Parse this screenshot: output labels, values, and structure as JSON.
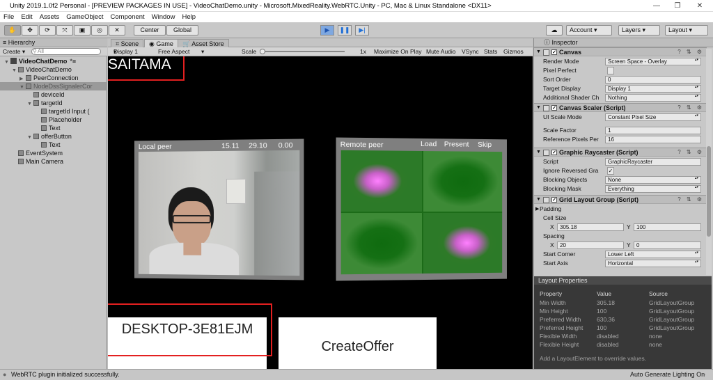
{
  "window": {
    "title": "Unity 2019.1.0f2 Personal - [PREVIEW PACKAGES IN USE] - VideoChatDemo.unity - Microsoft.MixedReality.WebRTC.Unity - PC, Mac & Linux Standalone <DX11>",
    "minimize": "—",
    "restore": "❐",
    "close": "✕"
  },
  "menu": [
    "File",
    "Edit",
    "Assets",
    "GameObject",
    "Component",
    "Window",
    "Help"
  ],
  "toolbar": {
    "center": "Center",
    "global": "Global",
    "account": "Account",
    "layers": "Layers",
    "layout": "Layout",
    "accent": "#1f6fd6"
  },
  "hierarchy": {
    "title": "Hierarchy",
    "create": "Create",
    "search_placeholder": "All",
    "items": [
      {
        "label": "VideoChatDemo",
        "indent": 0,
        "arrow": "▼",
        "bold": true,
        "suffix": "*≡"
      },
      {
        "label": "VideoChatDemo",
        "indent": 1,
        "arrow": "▼"
      },
      {
        "label": "PeerConnection",
        "indent": 2,
        "arrow": "▶"
      },
      {
        "label": "NodeDssSignalerCor",
        "indent": 2,
        "arrow": "▼",
        "selected": true
      },
      {
        "label": "deviceId",
        "indent": 3,
        "arrow": ""
      },
      {
        "label": "targetId",
        "indent": 3,
        "arrow": "▼"
      },
      {
        "label": "targetId Input (",
        "indent": 4,
        "arrow": ""
      },
      {
        "label": "Placeholder",
        "indent": 4,
        "arrow": ""
      },
      {
        "label": "Text",
        "indent": 4,
        "arrow": ""
      },
      {
        "label": "offerButton",
        "indent": 3,
        "arrow": "▼"
      },
      {
        "label": "Text",
        "indent": 4,
        "arrow": ""
      },
      {
        "label": "EventSystem",
        "indent": 1,
        "arrow": ""
      },
      {
        "label": "Main Camera",
        "indent": 1,
        "arrow": ""
      }
    ]
  },
  "game": {
    "tabs": [
      "Scene",
      "Game",
      "Asset Store"
    ],
    "display": "Display 1",
    "aspect": "Free Aspect",
    "scale_label": "Scale",
    "scale_value": "1x",
    "options": [
      "Maximize On Play",
      "Mute Audio",
      "VSync",
      "Stats",
      "Gizmos"
    ],
    "device_name": "SAITAMA",
    "local": {
      "label": "Local peer",
      "stats": [
        "15.11",
        "29.10",
        "0.00"
      ]
    },
    "remote": {
      "label": "Remote peer",
      "actions": [
        "Load",
        "Present",
        "Skip"
      ]
    },
    "target_input": "DESKTOP-3E81EJM",
    "offer_button": "CreateOffer",
    "highlight_color": "#e32020"
  },
  "inspector": {
    "title": "Inspector",
    "canvas": {
      "name": "Canvas",
      "fields": [
        {
          "label": "Render Mode",
          "value": "Screen Space - Overlay",
          "dropdown": true
        },
        {
          "label": "Pixel Perfect",
          "value": "",
          "checkbox": true
        },
        {
          "label": "Sort Order",
          "value": "0"
        },
        {
          "label": "Target Display",
          "value": "Display 1",
          "dropdown": true
        },
        {
          "label": "Additional Shader Ch",
          "value": "Nothing",
          "dropdown": true
        }
      ]
    },
    "scaler": {
      "name": "Canvas Scaler (Script)",
      "fields": [
        {
          "label": "UI Scale Mode",
          "value": "Constant Pixel Size",
          "dropdown": true
        },
        {
          "label": "Scale Factor",
          "value": "1"
        },
        {
          "label": "Reference Pixels Per",
          "value": "16"
        }
      ]
    },
    "raycaster": {
      "name": "Graphic Raycaster (Script)",
      "fields": [
        {
          "label": "Script",
          "value": "GraphicRaycaster"
        },
        {
          "label": "Ignore Reversed Gra",
          "value": "✓",
          "checkbox": true
        },
        {
          "label": "Blocking Objects",
          "value": "None",
          "dropdown": true
        },
        {
          "label": "Blocking Mask",
          "value": "Everything",
          "dropdown": true
        }
      ]
    },
    "grid": {
      "name": "Grid Layout Group (Script)",
      "padding": "Padding",
      "cell_size": "Cell Size",
      "cell_x": "305.18",
      "cell_y": "100",
      "spacing": "Spacing",
      "spacing_x": "20",
      "spacing_y": "0",
      "start_corner_label": "Start Corner",
      "start_corner": "Lower Left",
      "start_axis_label": "Start Axis",
      "start_axis": "Horizontal",
      "x": "X",
      "y": "Y"
    }
  },
  "layout_properties": {
    "title": "Layout Properties",
    "headers": [
      "Property",
      "Value",
      "Source"
    ],
    "rows": [
      [
        "Min Width",
        "305.18",
        "GridLayoutGroup"
      ],
      [
        "Min Height",
        "100",
        "GridLayoutGroup"
      ],
      [
        "Preferred Width",
        "630.36",
        "GridLayoutGroup"
      ],
      [
        "Preferred Height",
        "100",
        "GridLayoutGroup"
      ],
      [
        "Flexible Width",
        "disabled",
        "none"
      ],
      [
        "Flexible Height",
        "disabled",
        "none"
      ]
    ],
    "hint": "Add a LayoutElement to override values."
  },
  "status": {
    "message": "WebRTC plugin initialized successfully.",
    "right": "Auto Generate Lighting On"
  }
}
